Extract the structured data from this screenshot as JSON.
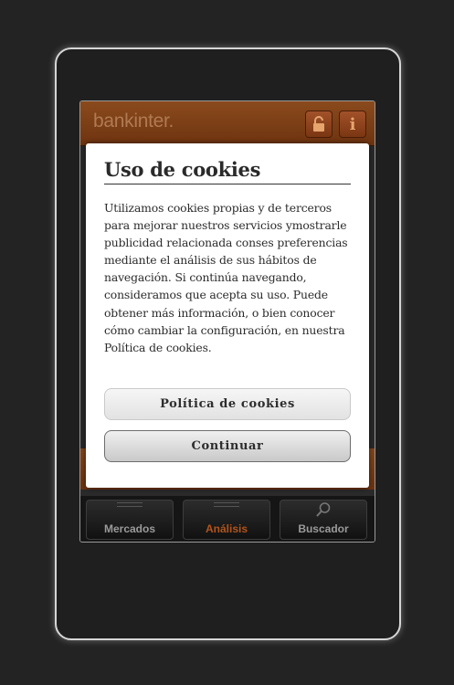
{
  "header": {
    "brand": "bankinter.",
    "lock_icon": "lock-icon",
    "info_icon": "info-icon",
    "info_glyph": "i"
  },
  "tabs": [
    {
      "label": "Mercados",
      "icon": "bars-icon",
      "active": false
    },
    {
      "label": "Análisis",
      "icon": "bars-icon",
      "active": true
    },
    {
      "label": "Buscador",
      "icon": "search-icon",
      "active": false
    }
  ],
  "cookie_dialog": {
    "title": "Uso de cookies",
    "body": "Utilizamos cookies propias y de terceros para mejorar nuestros servicios ymostrarle publicidad relacionada conses preferencias mediante el análisis de sus hábitos de navegación. Si continúa navegando, consideramos que acepta su uso. Puede obtener más información, o bien conocer cómo cambiar la configuración, en nuestra Política de cookies.",
    "policy_button": "Política de cookies",
    "continue_button": "Continuar"
  },
  "colors": {
    "accent": "#b2541c",
    "header": "#7a3a14"
  }
}
